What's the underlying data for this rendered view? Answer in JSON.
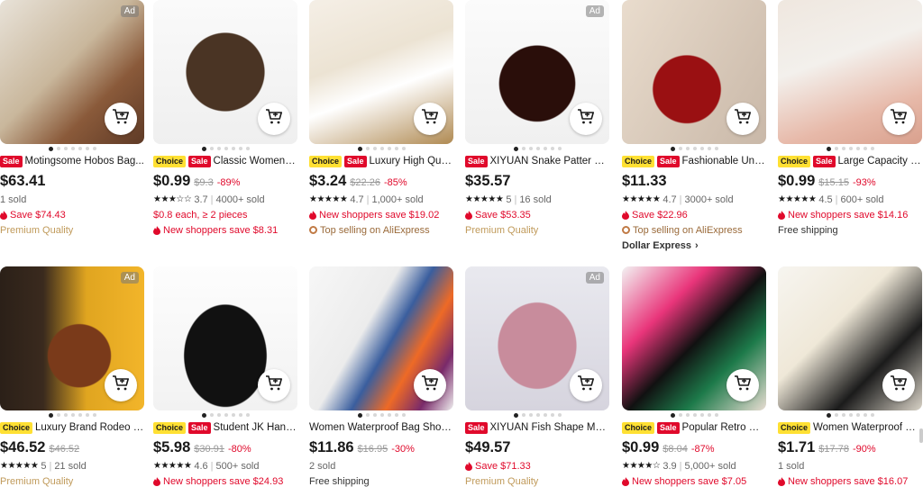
{
  "ui": {
    "ad_label": "Ad",
    "choice_label": "Choice",
    "sale_label": "Sale"
  },
  "products": [
    {
      "title": "Motingsome Hobos Bag...",
      "choice": false,
      "sale": true,
      "ad": true,
      "price": "$63.41",
      "lines": [
        {
          "kind": "gray",
          "text": "1 sold"
        },
        {
          "kind": "red-flame",
          "text": "Save $74.43"
        },
        {
          "kind": "gold",
          "text": "Premium Quality"
        }
      ]
    },
    {
      "title": "Classic Women Ba...",
      "choice": true,
      "sale": true,
      "ad": false,
      "price": "$0.99",
      "old": "$9.3",
      "disc": "-89%",
      "lines": [
        {
          "kind": "rating",
          "stars": "★★★☆☆",
          "rating": "3.7",
          "sold": "4000+ sold"
        },
        {
          "kind": "red",
          "text": "$0.8 each, ≥ 2 pieces"
        },
        {
          "kind": "red-flame",
          "text": "New shoppers save $8.31"
        }
      ]
    },
    {
      "title": "Luxury High Qualit...",
      "choice": true,
      "sale": true,
      "ad": false,
      "price": "$3.24",
      "old": "$22.26",
      "disc": "-85%",
      "lines": [
        {
          "kind": "rating",
          "stars": "★★★★★",
          "rating": "4.7",
          "sold": "1,000+ sold"
        },
        {
          "kind": "red-flame",
          "text": "New shoppers save $19.02"
        },
        {
          "kind": "brown-circ",
          "text": "Top selling on AliExpress"
        }
      ]
    },
    {
      "title": "XIYUAN Snake Patter Cl...",
      "choice": false,
      "sale": true,
      "ad": true,
      "price": "$35.57",
      "lines": [
        {
          "kind": "rating",
          "stars": "★★★★★",
          "rating": "5",
          "sold": "16 sold"
        },
        {
          "kind": "red-flame",
          "text": "Save $53.35"
        },
        {
          "kind": "gold",
          "text": "Premium Quality"
        }
      ]
    },
    {
      "title": "Fashionable Unde...",
      "choice": true,
      "sale": true,
      "ad": false,
      "price": "$11.33",
      "lines": [
        {
          "kind": "rating",
          "stars": "★★★★★",
          "rating": "4.7",
          "sold": "3000+ sold"
        },
        {
          "kind": "red-flame",
          "text": "Save $22.96"
        },
        {
          "kind": "brown-circ",
          "text": "Top selling on AliExpress"
        },
        {
          "kind": "dark-bold-chev",
          "text": "Dollar Express"
        }
      ]
    },
    {
      "title": "Large Capacity Sh...",
      "choice": true,
      "sale": true,
      "ad": false,
      "price": "$0.99",
      "old": "$15.15",
      "disc": "-93%",
      "lines": [
        {
          "kind": "rating",
          "stars": "★★★★★",
          "rating": "4.5",
          "sold": "600+ sold"
        },
        {
          "kind": "red-flame",
          "text": "New shoppers save $14.16"
        },
        {
          "kind": "dark",
          "text": "Free shipping"
        }
      ]
    },
    {
      "title": "Luxury Brand Rodeo W...",
      "choice": true,
      "sale": false,
      "ad": true,
      "price": "$46.52",
      "old": "$46.52",
      "lines": [
        {
          "kind": "rating",
          "stars": "★★★★★",
          "rating": "5",
          "sold": "21 sold"
        },
        {
          "kind": "gold",
          "text": "Premium Quality"
        }
      ]
    },
    {
      "title": "Student JK Handb...",
      "choice": true,
      "sale": true,
      "ad": false,
      "price": "$5.98",
      "old": "$30.91",
      "disc": "-80%",
      "lines": [
        {
          "kind": "rating",
          "stars": "★★★★★",
          "rating": "4.6",
          "sold": "500+ sold"
        },
        {
          "kind": "red-flame",
          "text": "New shoppers save $24.93"
        }
      ]
    },
    {
      "title": "Women Waterproof Bag Shou...",
      "choice": false,
      "sale": false,
      "ad": false,
      "price": "$11.86",
      "old": "$16.95",
      "disc": "-30%",
      "lines": [
        {
          "kind": "gray",
          "text": "2 sold"
        },
        {
          "kind": "dark",
          "text": "Free shipping"
        }
      ]
    },
    {
      "title": "XIYUAN Fish Shape Mult...",
      "choice": false,
      "sale": true,
      "ad": true,
      "price": "$49.57",
      "lines": [
        {
          "kind": "red-flame",
          "text": "Save $71.33"
        },
        {
          "kind": "gold",
          "text": "Premium Quality"
        }
      ]
    },
    {
      "title": "Popular Retro Gen...",
      "choice": true,
      "sale": true,
      "ad": false,
      "price": "$0.99",
      "old": "$8.04",
      "disc": "-87%",
      "lines": [
        {
          "kind": "rating",
          "stars": "★★★★☆",
          "rating": "3.9",
          "sold": "5,000+ sold"
        },
        {
          "kind": "red-flame",
          "text": "New shoppers save $7.05"
        }
      ]
    },
    {
      "title": "Women Waterproof Nyl...",
      "choice": true,
      "sale": false,
      "ad": false,
      "price": "$1.71",
      "old": "$17.78",
      "disc": "-90%",
      "lines": [
        {
          "kind": "gray",
          "text": "1 sold"
        },
        {
          "kind": "red-flame",
          "text": "New shoppers save $16.07"
        }
      ]
    }
  ]
}
